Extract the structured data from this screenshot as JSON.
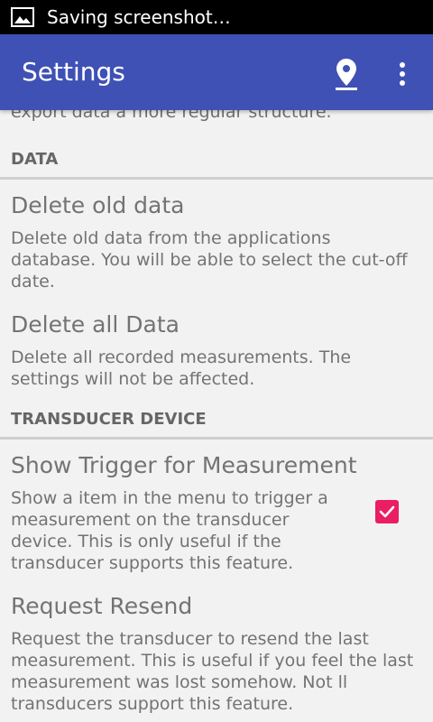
{
  "status_bar": {
    "notification_icon": "image-icon",
    "text": "Saving screenshot…"
  },
  "app_bar": {
    "title": "Settings",
    "location_icon": "location-pin-icon",
    "overflow_icon": "more-vert-icon"
  },
  "colors": {
    "primary": "#3f51b5",
    "accent": "#e91e63",
    "background": "#f2f2f2"
  },
  "preferences": {
    "clipped_summary": "export data a more regular structure.",
    "categories": [
      {
        "header": "DATA",
        "items": [
          {
            "title": "Delete old data",
            "summary": "Delete old data from the applications database. You will be able to select the cut-off date."
          },
          {
            "title": "Delete all Data",
            "summary": "Delete all recorded measurements. The settings will not be affected."
          }
        ]
      },
      {
        "header": "TRANSDUCER DEVICE",
        "items": [
          {
            "title": "Show Trigger for Measurement",
            "summary": "Show a item in the menu to trigger a measurement on the transducer device. This is only useful if the transducer supports this feature.",
            "checked": true,
            "checkbox_icon": "check-icon"
          },
          {
            "title": "Request Resend",
            "summary": "Request the transducer to resend the last measurement. This is useful if you feel the last measurement was lost somehow. Not ll transducers support this feature."
          }
        ]
      }
    ]
  }
}
